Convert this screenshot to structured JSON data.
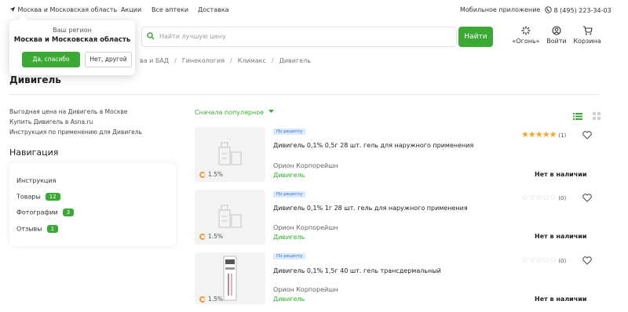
{
  "topbar": {
    "region": "Москва и Московская область",
    "links": [
      "Акции",
      "Все аптеки",
      "Доставка"
    ],
    "app": "Мобильное приложение",
    "phone": "8 (495) 223-34-03"
  },
  "search": {
    "placeholder": "Найти лучшую цену",
    "button": "Найти"
  },
  "header_icons": {
    "ogon": "«Огонь»",
    "login": "Войти",
    "cart": "Корзина"
  },
  "breadcrumb": [
    "ва и БАД",
    "Гинекология",
    "Климакс",
    "Дивигель"
  ],
  "page_title": "Дивигель",
  "side_links": [
    "Выгодная цена на Дивигель в Москве",
    "Купить Дивигель в Asna.ru",
    "Инструкция по применению для Дивигель"
  ],
  "navigation": {
    "title": "Навигация",
    "items": [
      {
        "label": "Инструкция",
        "badge": null
      },
      {
        "label": "Товары",
        "badge": "12"
      },
      {
        "label": "Фотографии",
        "badge": "3"
      },
      {
        "label": "Отзывы",
        "badge": "1"
      }
    ]
  },
  "sort": {
    "label": "Сначала популярное"
  },
  "products": [
    {
      "tag": "По рецепту",
      "name": "Дивигель 0,1% 0,5г 28 шт. гель для наружного применения",
      "manufacturer": "Орион Корпорейшн",
      "brand": "Дивигель",
      "cashback": "1.5%",
      "rating": 5,
      "reviews": "(1)",
      "stock": "Нет в наличии"
    },
    {
      "tag": "По рецепту",
      "name": "Дивигель 0,1% 1г 28 шт. гель для наружного применения",
      "manufacturer": "Орион Корпорейшн",
      "brand": "Дивигель",
      "cashback": "1.5%",
      "rating": 0,
      "reviews": "(0)",
      "stock": "Нет в наличии"
    },
    {
      "tag": "По рецепту",
      "name": "Дивигель 0,1% 1,5г 40 шт. гель трансдермальный",
      "manufacturer": "Орион Корпорейшн",
      "brand": "Дивигель",
      "cashback": "1.5%",
      "rating": 0,
      "reviews": "(0)",
      "stock": "Нет в наличии"
    }
  ],
  "region_popup": {
    "label": "Ваш регион",
    "region": "Москва и Московская область",
    "confirm": "Да, спасибо",
    "other": "Нет, другой"
  },
  "colors": {
    "accent": "#3aaa35",
    "star": "#f5a623",
    "rx_bg": "#dbe9ff"
  }
}
